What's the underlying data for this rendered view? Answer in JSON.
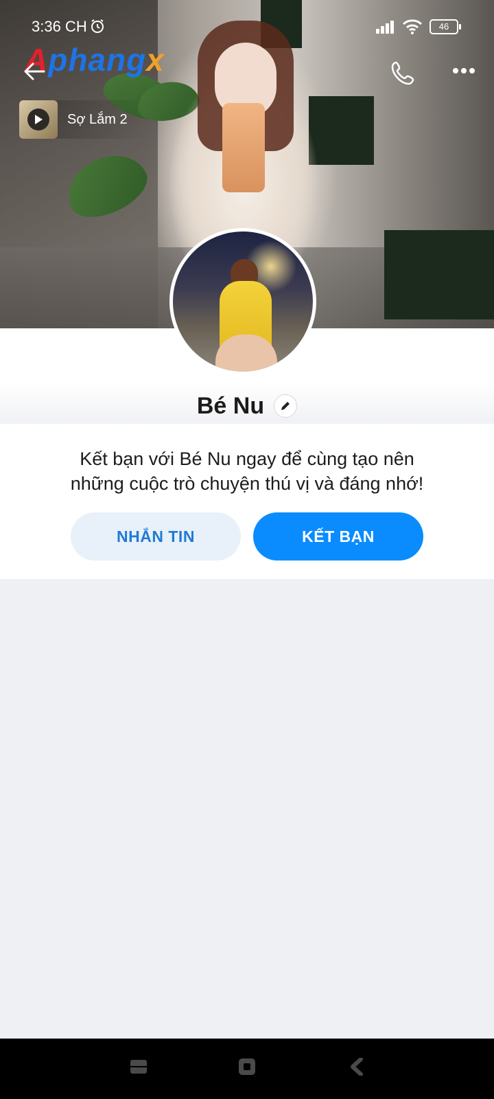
{
  "status_bar": {
    "time": "3:36 CH",
    "battery": "46",
    "icons": [
      "alarm-icon",
      "signal-icon",
      "wifi-icon",
      "battery-icon"
    ]
  },
  "watermark": {
    "part1": "A",
    "part2": "phang",
    "part3": "x"
  },
  "header": {
    "icons": [
      "back-arrow-icon",
      "phone-icon",
      "more-icon"
    ]
  },
  "music": {
    "title": "Sợ Lắm 2"
  },
  "profile": {
    "name": "Bé Nu"
  },
  "invite": {
    "line1": "Kết bạn với Bé Nu ngay để cùng tạo nên",
    "line2": "những cuộc trò chuyện thú vị và đáng nhớ!"
  },
  "actions": {
    "message_label": "NHẮN TIN",
    "add_friend_label": "KẾT BẠN"
  },
  "colors": {
    "accent": "#0a8cff",
    "secondary_bg": "#e8f1f9",
    "page_bg": "#eef0f4"
  },
  "nav": {
    "icons": [
      "recent-apps-icon",
      "home-icon",
      "back-icon"
    ]
  }
}
